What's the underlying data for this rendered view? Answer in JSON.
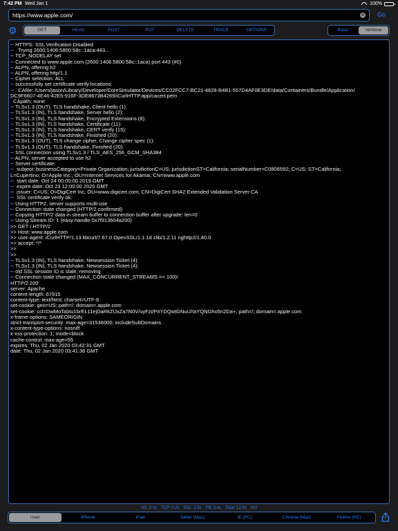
{
  "status_bar": {
    "time": "7:42 PM",
    "date": "Wed Jan 1",
    "battery": "100%"
  },
  "url_bar": {
    "value": "https://www.apple.com/",
    "go_label": "Go"
  },
  "methods": {
    "items": [
      "GET",
      "HEAD",
      "POST",
      "PUT",
      "DELETE",
      "TRACE",
      "OPTIONS"
    ],
    "selected": "GET"
  },
  "modes": {
    "items": [
      "Basic",
      "Verbose"
    ],
    "selected": "Verbose"
  },
  "log": {
    "lines": [
      "-- HTTPS: SSL Verification Disabled",
      "--   Trying 2600:1406:5800:58c::1aca:443...",
      "-- TCP_NODELAY set",
      "-- Connected to www.apple.com (2600:1406:5800:58c::1aca) port 443 (#0)",
      "-- ALPN, offering h2",
      "-- ALPN, offering http/1.1",
      "-- Cipher selection: ALL",
      "-- successfully set certificate verify locations:",
      "--   CAfile: /Users/jason/Library/Developer/CoreSimulator/Devices/CC02FCC7-BC21-4828-B4B1-557D4AF0E3DE/data/Containers/Bundle/Application/",
      "DC9F6607-4E46-42E5-916F-3DE8673B4269/iCurlHTTP.app/cacert.pem",
      "  CApath: none",
      "-- TLSv1.3 (OUT), TLS handshake, Client hello (1):",
      "-- TLSv1.3 (IN), TLS handshake, Server hello (2):",
      "-- TLSv1.3 (IN), TLS handshake, Encrypted Extensions (8):",
      "-- TLSv1.3 (IN), TLS handshake, Certificate (11):",
      "-- TLSv1.3 (IN), TLS handshake, CERT verify (15):",
      "-- TLSv1.3 (IN), TLS handshake, Finished (20):",
      "-- TLSv1.3 (OUT), TLS change cipher, Change cipher spec (1):",
      "-- TLSv1.3 (OUT), TLS handshake, Finished (20):",
      "-- SSL connection using TLSv1.3 / TLS_AES_256_GCM_SHA384",
      "-- ALPN, server accepted to use h2",
      "-- Server certificate:",
      "--  subject: businessCategory=Private Organization; jurisdictionC=US; jurisdictionST=California; serialNumber=C0806592; C=US; ST=California;",
      "L=Cupertino; O=Apple Inc.; OU=Internet Services for Akamai; CN=www.apple.com",
      "--  start date: Oct 24 00:00:00 2019 GMT",
      "--  expire date: Oct 23 12:00:00 2020 GMT",
      "--  issuer: C=US; O=DigiCert Inc; OU=www.digicert.com; CN=DigiCert SHA2 Extended Validation Server CA",
      "--  SSL certificate verify ok.",
      "-- Using HTTP2, server supports multi-use",
      "-- Connection state changed (HTTP/2 confirmed)",
      "-- Copying HTTP/2 data in stream buffer to connection buffer after upgrade: len=0",
      "-- Using Stream ID: 1 (easy handle 0x7f913604a200)",
      ">> GET / HTTP/2",
      ">> Host: www.apple.com",
      ">> user-agent: iCurlHTTP/1.13 libcurl/7.67.0 OpenSSL/1.1.1d zlib/1.2.11 nghttp2/1.40.0",
      ">> accept: */*",
      ">>",
      ">>",
      "-- TLSv1.3 (IN), TLS handshake, Newsession Ticket (4):",
      "-- TLSv1.3 (IN), TLS handshake, Newsession Ticket (4):",
      "-- old SSL session ID is stale, removing",
      "-- Connection state changed (MAX_CONCURRENT_STREAMS == 100)!",
      "HTTP/2 200",
      "server: Apache",
      "content-length: 67915",
      "content-type: text/html; charset=UTF-8",
      "set-cookie: geo=US; path=/; domain=.apple.com",
      "set-cookie: ccl=DwMoTabtu1brEL11ejDaRkZUxZa7N0V/uyFzi/P4YDQwtGNuU/IaYQNGho5n2Da+; path=/; domain=.apple.com",
      "x-frame-options: SAMEORIGIN",
      "strict-transport-security: max-age=31536000; includeSubDomains",
      "x-content-type-options: nosniff",
      "x-xss-protection: 1; mode=block",
      "cache-control: max-age=55",
      "expires: Thu, 02 Jan 2020 03:42:31 GMT",
      "date: Thu, 02 Jan 2020 03:41:36 GMT"
    ]
  },
  "timing": [
    "NS: 0.0s",
    "TCP: 0.2s",
    "SSL: 2.5s",
    "FB: 3.4s",
    "Total: 12.9s",
    "H/2"
  ],
  "user_agents": {
    "items": [
      "User",
      "iPhone",
      "iPad",
      "Safari (Mac)",
      "IE (PC)",
      "Chrome (Mac)",
      "Firefox (PC)"
    ],
    "selected": "User"
  },
  "colors": {
    "accent": "#2f7bf6",
    "border": "#3d6fb3",
    "selected": "#9a9aa0",
    "background": "#1c1c1e",
    "log_bg": "#000000"
  },
  "icons": {
    "settings": "gear-icon",
    "clear": "clear-icon",
    "share": "share-icon",
    "wifi": "wifi-icon",
    "battery": "battery-icon"
  }
}
